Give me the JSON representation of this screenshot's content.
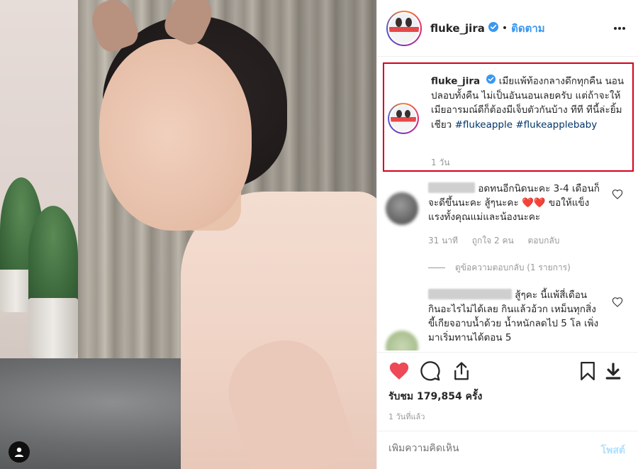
{
  "post": {
    "username": "fluke_jira",
    "separator": "•",
    "follow_label": "ติดตาม",
    "more_icon": "more-dots-icon",
    "verified_icon": "verified-badge-icon"
  },
  "caption": {
    "username": "fluke_jira",
    "text": "เมียแพ้ท้องกลางดึกทุกคืน นอนปลอบทั้งคืน ไม่เป็นอันนอนเลยครับ แต่ถ้าจะให้เมียอารมณ์ดีก็ต้องมีเจ็บตัวกันบ้าง ทีที ทีนี้ล่ะยิ้มเชียว",
    "hashtags": [
      "#flukeapple",
      "#flukeapplebaby"
    ],
    "time": "1 วัน",
    "highlight_color": "#d6001c"
  },
  "comments": [
    {
      "text": "อดทนอีกนิดนะคะ 3-4 เดือนก็จะดีขึ้นนะคะ สู้ๆนะคะ ❤️❤️ ขอให้แข็งแรงทั้งคุณแม่และน้องนะคะ",
      "time": "31 นาที",
      "likes": "ถูกใจ 2 คน",
      "reply_label": "ตอบกลับ",
      "view_replies": "ดูข้อความตอบกลับ (1 รายการ)"
    },
    {
      "text": "สู้ๆคะ นี้แพ้สี่เดือน กินอะไรไม่ได้เลย กินแล้วอ้วก เหม็นทุกสิ่ง ขี้เกียจอาบน้ำด้วย น้ำหนักลดไป 5 โล เพิ่งมาเริ่มทานได้ตอน 5"
    }
  ],
  "actions": {
    "like_icon": "heart-filled-icon",
    "comment_icon": "comment-bubble-icon",
    "share_icon": "share-upload-icon",
    "save_icon": "bookmark-icon",
    "download_icon": "download-icon",
    "like_color": "#ed4956"
  },
  "stats": {
    "views": "รับชม 179,854 ครั้ง",
    "posted": "1 วันที่แล้ว"
  },
  "add_comment": {
    "placeholder": "เพิ่มความคิดเห็น",
    "post_label": "โพสต์"
  },
  "media": {
    "user_tag_icon": "user-tag-icon"
  }
}
